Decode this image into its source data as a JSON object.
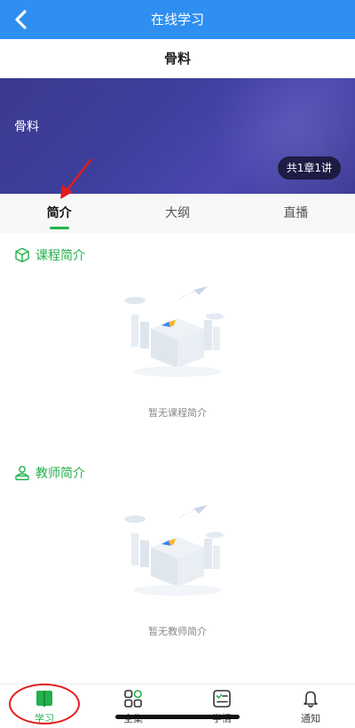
{
  "header": {
    "title": "在线学习",
    "back_icon": "chevron-left-icon"
  },
  "course": {
    "name": "骨料",
    "banner_name": "骨料",
    "lesson_count": "共1章1讲"
  },
  "tabs": [
    {
      "label": "简介",
      "active": true
    },
    {
      "label": "大纲",
      "active": false
    },
    {
      "label": "直播",
      "active": false
    }
  ],
  "sections": {
    "course_intro": {
      "title": "课程简介",
      "empty_text": "暂无课程简介",
      "icon": "cube-icon"
    },
    "teacher_intro": {
      "title": "教师简介",
      "empty_text": "暂无教师简介",
      "icon": "teacher-icon"
    }
  },
  "bottom_nav": [
    {
      "label": "学习",
      "icon": "book-icon",
      "active": true
    },
    {
      "label": "全集",
      "icon": "apps-grid-icon",
      "active": false
    },
    {
      "label": "学情",
      "icon": "checklist-icon",
      "active": false
    },
    {
      "label": "通知",
      "icon": "bell-icon",
      "active": false
    }
  ],
  "colors": {
    "primary": "#2e8ff0",
    "accent_green": "#22b14c",
    "banner": "#3d3f9c",
    "annotation_red": "#e11d1d"
  }
}
